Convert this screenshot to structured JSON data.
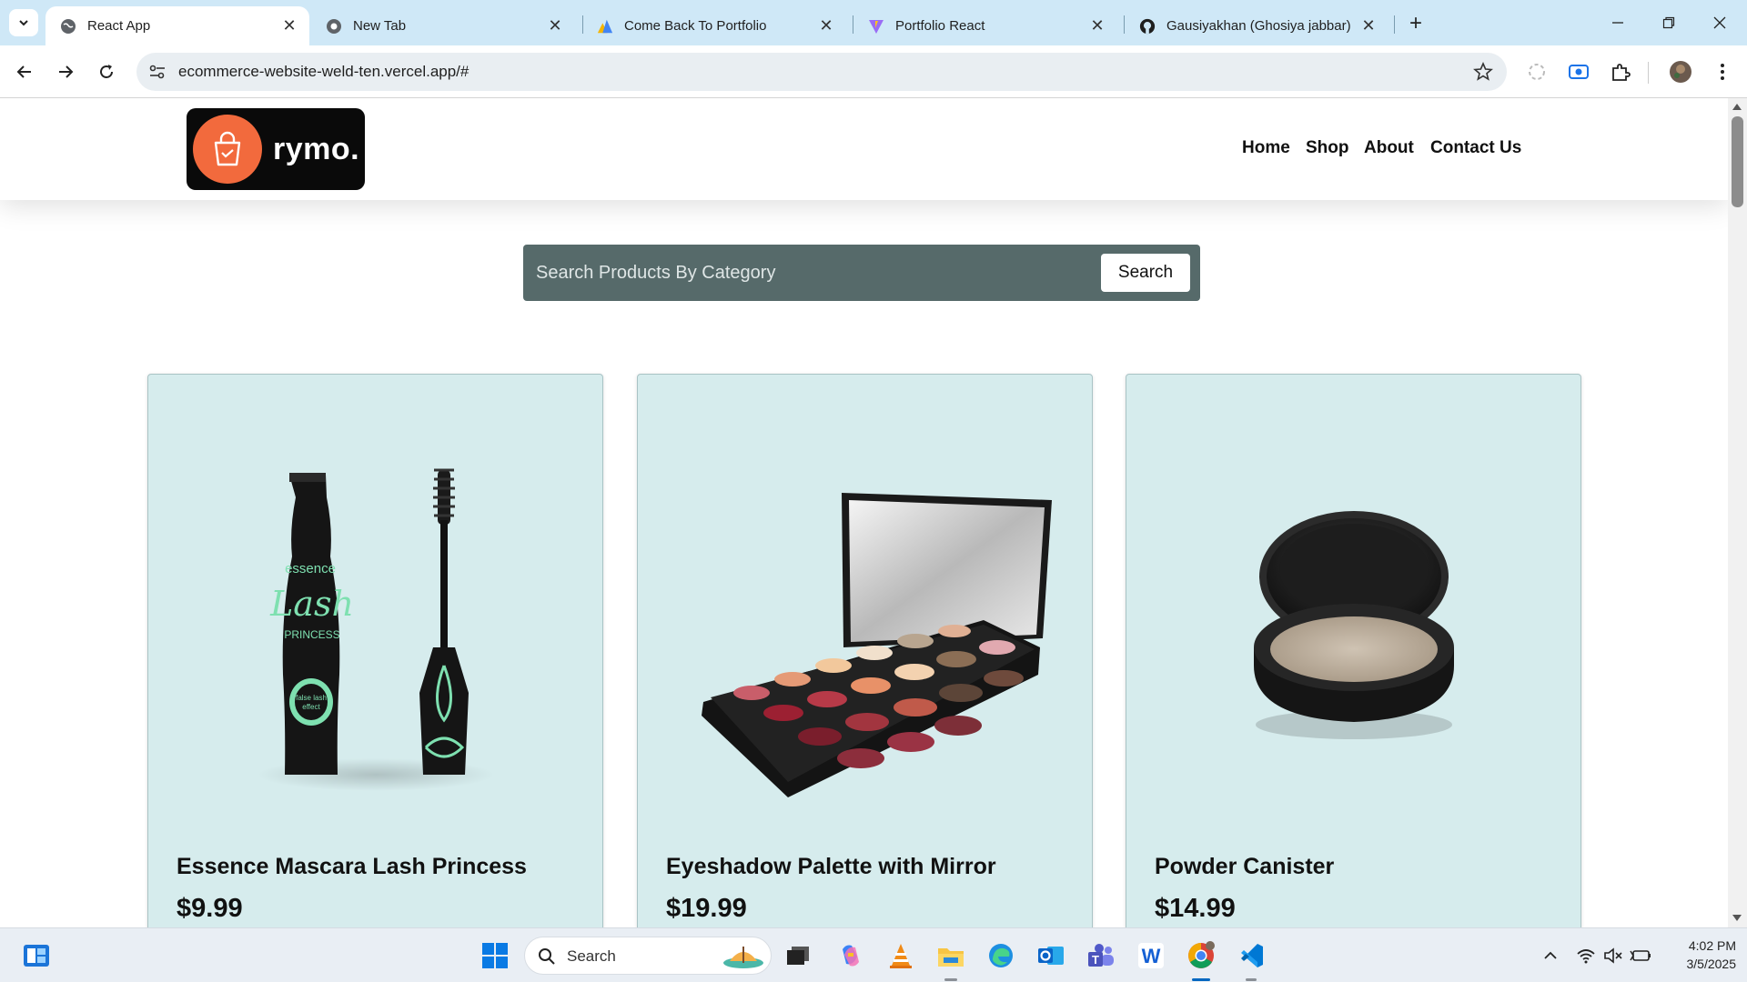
{
  "browser": {
    "tabs": [
      {
        "title": "React App",
        "active": true,
        "favicon": "globe-icon"
      },
      {
        "title": "New Tab",
        "active": false,
        "favicon": "chrome-icon"
      },
      {
        "title": "Come Back To Portfolio",
        "active": false,
        "favicon": "triangles-icon"
      },
      {
        "title": "Portfolio React",
        "active": false,
        "favicon": "vite-icon"
      },
      {
        "title": "Gausiyakhan (Ghosiya jabbar)",
        "active": false,
        "favicon": "github-icon"
      }
    ],
    "url": "ecommerce-website-weld-ten.vercel.app/#"
  },
  "site": {
    "brand": "rymo.",
    "nav": [
      "Home",
      "Shop",
      "About",
      "Contact Us"
    ],
    "search": {
      "placeholder": "Search Products By Category",
      "button": "Search"
    },
    "products": [
      {
        "name": "Essence Mascara Lash Princess",
        "price": "$9.99",
        "image": "mascara-image"
      },
      {
        "name": "Eyeshadow Palette with Mirror",
        "price": "$19.99",
        "image": "eyeshadow-palette-image"
      },
      {
        "name": "Powder Canister",
        "price": "$14.99",
        "image": "powder-compact-image"
      }
    ]
  },
  "taskbar": {
    "search_label": "Search",
    "time": "4:02 PM",
    "date": "3/5/2025"
  },
  "colors": {
    "accent": "#f26a3d",
    "card_bg": "#d6eced",
    "search_bg": "#566a6a",
    "tabstrip_bg": "#cfe8f7"
  }
}
